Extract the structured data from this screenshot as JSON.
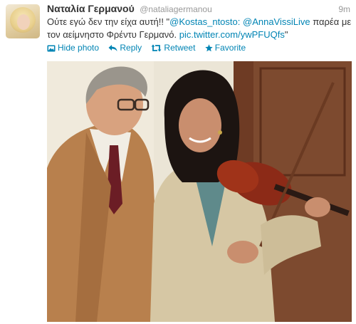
{
  "tweet": {
    "full_name": "Ναταλία Γερμανού",
    "username": "@nataliagermanou",
    "time": "9m",
    "text_prefix": "Ούτε εγώ δεν την είχα αυτή!! \"",
    "mention1": "@Kostas_ntosto",
    "text_colon": ": ",
    "mention2": "@AnnaVissiLive",
    "text_middle": " παρέα με τον αείμνηστο Φρέντυ Γερμανό. ",
    "pic_link": "pic.twitter.com/ywPFUQfs",
    "text_suffix": "\""
  },
  "actions": {
    "hide_photo": "Hide photo",
    "reply": "Reply",
    "retweet": "Retweet",
    "favorite": "Favorite"
  },
  "icons": {
    "photo": "photo-icon",
    "reply": "reply-icon",
    "retweet": "retweet-icon",
    "favorite": "star-icon"
  },
  "colors": {
    "link": "#0084b4",
    "name": "#333333",
    "meta": "#999999"
  }
}
